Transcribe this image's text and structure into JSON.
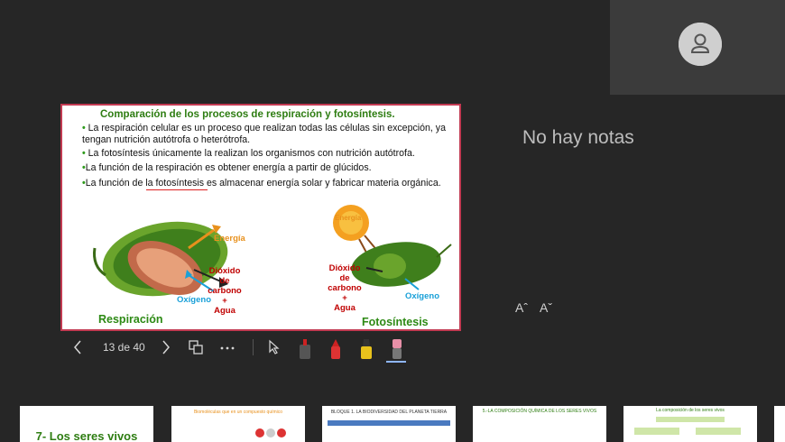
{
  "notes": {
    "empty_label": "No hay notas"
  },
  "font_controls": {
    "increase": "Aˆ",
    "decrease": "Aˇ"
  },
  "navigation": {
    "counter": "13 de 40"
  },
  "slide": {
    "title": "Comparación de los procesos de respiración y fotosíntesis.",
    "bullets": [
      "La respiración celular es un proceso que realizan todas las células sin excepción, ya tengan nutrición autótrofa o heterótrofa.",
      "La fotosíntesis únicamente la realizan los organismos con nutrición autótrofa.",
      "La función de la respiración es obtener energía a partir de glúcidos.",
      "La función de la fotosíntesis es almacenar energía solar y fabricar materia orgánica."
    ],
    "left_diagram": {
      "energy": "Energía",
      "products": [
        "Dióxido",
        "de",
        "carbono",
        "+",
        "Agua"
      ],
      "oxygen": "Oxígeno",
      "caption": "Respiración"
    },
    "right_diagram": {
      "sun": "Energía",
      "inputs": [
        "Dióxido",
        "de",
        "carbono",
        "+",
        "Agua"
      ],
      "oxygen": "Oxígeno",
      "caption": "Fotosíntesis"
    }
  },
  "thumbnails": [
    {
      "title": "7- Los seres vivos"
    },
    {
      "title": "Biomoléculas que en un compuesto químico"
    },
    {
      "title": "BLOQUE 1. LA BIODIVERSIDAD DEL PLANETA TIERRA"
    },
    {
      "title": "5.-LA COMPOSICIÓN QUÍMICA DE LOS SERES VIVOS"
    },
    {
      "title": "La composición de los seres vivos"
    }
  ],
  "colors": {
    "accent_border": "#c23a52",
    "green_text": "#2e7d12",
    "red_text": "#c00000",
    "orange_text": "#e8901c",
    "blue_text": "#19a0d8"
  }
}
